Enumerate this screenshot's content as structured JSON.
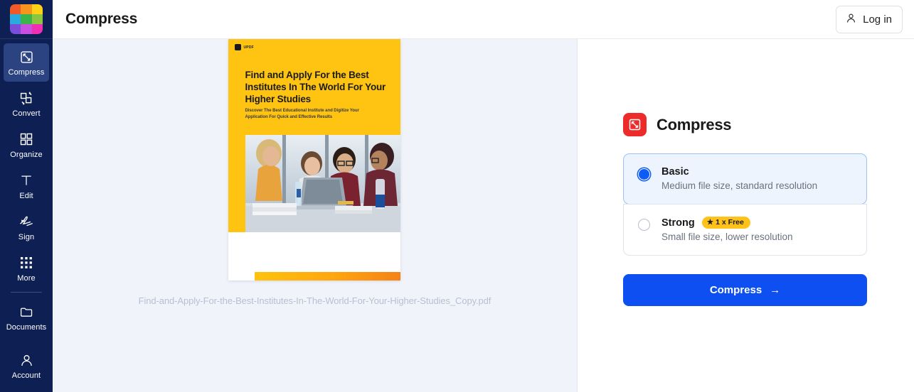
{
  "brand": {
    "logo_name": "app-logo-grid",
    "logo_colors": [
      "#f05a28",
      "#f7941e",
      "#fcd116",
      "#29abe2",
      "#39b54a",
      "#8cc63f",
      "#7a4ed9",
      "#c94fe0",
      "#f02fb2"
    ]
  },
  "sidebar": {
    "items": [
      {
        "label": "Compress",
        "icon": "compress-icon",
        "active": true
      },
      {
        "label": "Convert",
        "icon": "convert-icon",
        "active": false
      },
      {
        "label": "Organize",
        "icon": "organize-icon",
        "active": false
      },
      {
        "label": "Edit",
        "icon": "edit-text-icon",
        "active": false
      },
      {
        "label": "Sign",
        "icon": "signature-icon",
        "active": false
      },
      {
        "label": "More",
        "icon": "grid-dots-icon",
        "active": false
      },
      {
        "label": "Documents",
        "icon": "folder-icon",
        "active": false
      }
    ],
    "account": {
      "label": "Account",
      "icon": "user-icon"
    }
  },
  "topbar": {
    "title": "Compress",
    "login_label": "Log in",
    "login_icon": "user-icon"
  },
  "canvas": {
    "file_name": "Find-and-Apply-For-the-Best-Institutes-In-The-World-For-Your-Higher-Studies_Copy.pdf",
    "document_preview": {
      "brand_text": "UPDF",
      "heading": "Find and Apply For the Best Institutes In The World For Your Higher Studies",
      "subheading": "Discover The Best Educational Institute and Digitize Your Application For Quick and Effective Results",
      "photo_alt": "students-studying-photo",
      "accent_color": "#ffc411"
    }
  },
  "panel": {
    "icon": "compress-icon",
    "icon_color": "#ec2b2b",
    "title": "Compress",
    "options": [
      {
        "title": "Basic",
        "description": "Medium file size, standard resolution",
        "selected": true,
        "badge": null
      },
      {
        "title": "Strong",
        "description": "Small file size, lower resolution",
        "selected": false,
        "badge": {
          "star": "★",
          "text": "1 x Free",
          "color": "#ffc21a"
        }
      }
    ],
    "cta": {
      "label": "Compress",
      "arrow": "→",
      "color": "#0d4ff0"
    }
  }
}
